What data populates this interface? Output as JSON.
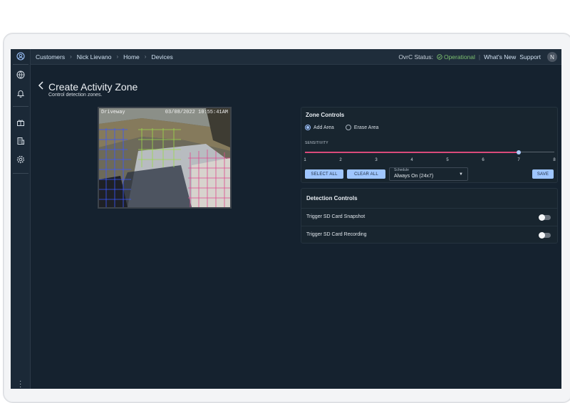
{
  "colors": {
    "background": "#15222f",
    "accent": "#9fc6ff",
    "slider_fill": "#d94a7a",
    "status_ok": "#7cc070"
  },
  "sidebar": {
    "icons": [
      "user-circle-icon",
      "globe-icon",
      "bell-icon",
      "gift-icon",
      "building-icon",
      "settings-icon",
      "kebab-menu-icon"
    ]
  },
  "topbar": {
    "breadcrumbs": [
      "Customers",
      "Nick Lievano",
      "Home",
      "Devices"
    ],
    "status_label": "OvrC Status:",
    "status_value": "Operational",
    "whats_new": "What's New",
    "support": "Support",
    "avatar_initial": "N"
  },
  "page": {
    "title": "Create Activity Zone",
    "subtitle": "Control detection zones."
  },
  "camera": {
    "label": "Driveway",
    "timestamp": "03/08/2022 10:55:41AM"
  },
  "zone_controls": {
    "title": "Zone Controls",
    "mode_options": [
      "Add Area",
      "Erase Area"
    ],
    "selected_mode": "Add Area",
    "sensitivity_label": "SENSITIVITY",
    "sensitivity_ticks": [
      "1",
      "2",
      "3",
      "4",
      "5",
      "6",
      "7",
      "8"
    ],
    "sensitivity_value": 7,
    "select_all": "SELECT ALL",
    "clear_all": "CLEAR ALL",
    "schedule_label": "Schedule",
    "schedule_value": "Always On (24x7)",
    "save": "SAVE"
  },
  "detection_controls": {
    "title": "Detection Controls",
    "items": [
      {
        "label": "Trigger SD Card Snapshot",
        "enabled": false
      },
      {
        "label": "Trigger SD Card Recording",
        "enabled": false
      }
    ]
  }
}
